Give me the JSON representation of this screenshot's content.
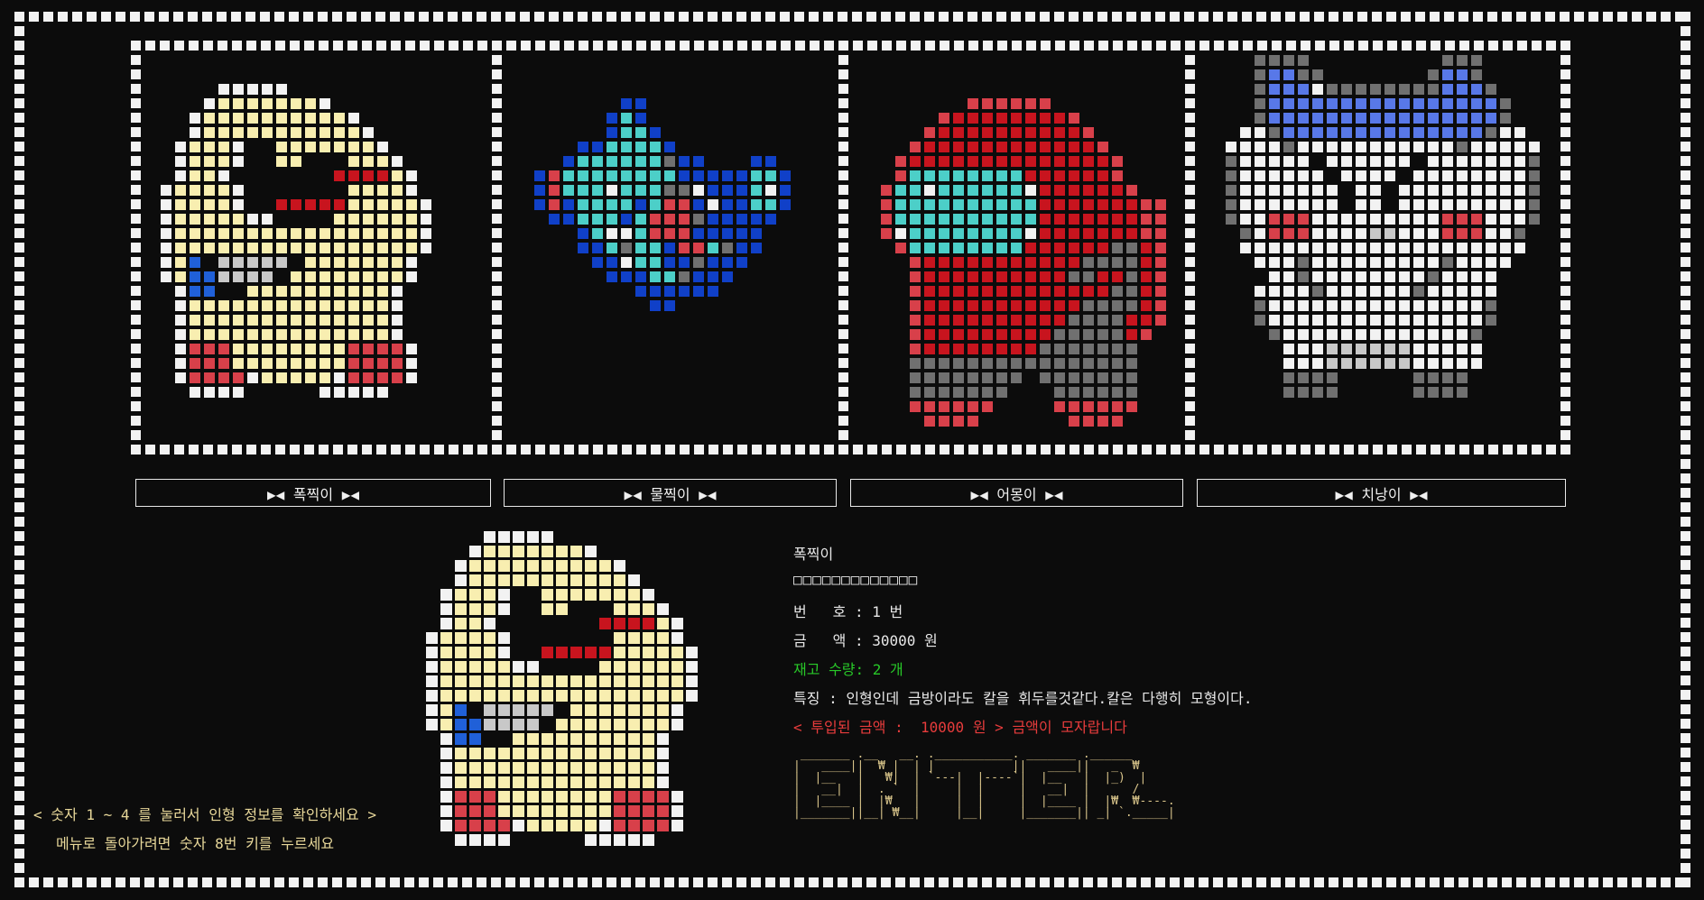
{
  "colors": {
    "W": "#f2f2f2",
    "Y": "#f8eeb0",
    "R": "#d8404a",
    "D": "#c8141e",
    "B": "#2060d8",
    "K": "#1040c8",
    "C": "#4ccfc8",
    "G": "#c8c8c8",
    "M": "#707070",
    "A": "#5878e8",
    "status_green": "#28c828",
    "warn_red": "#e83c3c",
    "hint_yellow": "#e8d89a"
  },
  "dolls": [
    {
      "label": "▶◀  폭찍이  ▶◀",
      "sprite": "pokjjik"
    },
    {
      "label": "▶◀  물찍이  ▶◀",
      "sprite": "muljjik"
    },
    {
      "label": "▶◀  어몽이  ▶◀",
      "sprite": "eomong"
    },
    {
      "label": "▶◀  치낭이  ▶◀",
      "sprite": "chinang"
    }
  ],
  "sprites": {
    "pokjjik": [
      "....WWWWW.........",
      "...WYYYYYYYW......",
      "..WYYYYYYYYYYW....",
      "..WYYYYYYYYYYYW...",
      ".WYYYW..YYYYYYYW..",
      ".WYYYW..YY...YYYW.",
      ".WYYW.......DDDDYW",
      "WYYYYW.......YYYYW",
      "WYYYYW..DDDDDYYYYYW",
      "WYYYYYWW....YYYYYYW",
      "WYYYYYYYYYYYYYYYYYW",
      "WYYYYYYYYYYYYYYYYYW",
      "WYB.GGGGG.YYYYYYYW",
      "WYBBGGGG.YYYYYYYYW",
      ".WBB..YYYYYYYYYYW.",
      ".WYYYYYYYYYYYYYYW.",
      ".WYYYYYYYYYYYYYYW.",
      ".WYYYYYYYYYYYYYYW.",
      ".WRRRYYYYYYYYRRRRW",
      ".WRRRYYYYYYYYRRRRW",
      ".WRRRRWYYYYYWRRRRW",
      "..WWWW.....WWWWW.."
    ],
    "muljjik": [
      "......KK..........",
      ".....KCK..........",
      ".....KCCK.........",
      "...KKCCCCK........",
      "..KCCCCCCMKK...KK.",
      "KRCCCCCCCCKKKKKCCK",
      "KRCCCWCCCMMWKKKCWK",
      "KRKCCCCKCRRKWKKCCK",
      ".KKCCCKCRRRMKKKKK.",
      "...KCWWCRRRKKKKK..",
      "...KKCMCCKRRCMKK..",
      "....KKWCCKKMKKK...",
      ".....KKKCCMKKK....",
      ".......KKKKKK.....",
      "........KK........"
    ],
    "eomong": [
      "......RRRRRR......",
      "....RDDDDDDDDR....",
      "...RDDDDDDDDDDR...",
      "..RDDDDDDDDDDDDR..",
      ".RDDDDDDDDDDDDDDR.",
      ".RCCCCCCCCDDDDDDR.",
      "RCCWCCCCCCWDDDDDDR",
      "RCCCCCCCCCCDDDDDDDRR",
      "RCCCCCCCCCCDDDDDDDRR",
      "RWCCCCCCCCWDDDDDDDRR",
      ".RCCCCCCCCDDDDDDMMDR",
      "..RDDDDDDDDDDDMMMMDR",
      "..RDDDDDDDDDDMMDDMDR",
      "..RDDDDDDDDDDDDDMMDR",
      "..RDDDDDDDDDDDMMMMDR",
      "..RDDDDDDDDDDMMMMDDR",
      "..RDDDDDDDDDMMMMMDR.",
      "..RDDDDDDDDMMMMMMM..",
      "..MMMMMMMMMMMMMMMM..",
      "..MMMMMMMM.MMMMMMM..",
      "..MMMMMMM...MMMMMM..",
      "..RRRRRR....RRRRRR..",
      "...RRRR......RRRR..."
    ],
    "chinang": [
      "..MMMM.........MMM....",
      "..MAAMM.......MAAM....",
      "..MAAAWMMMMMMMMAAAM...",
      "..MAAAAAAAAAAAAAAAAM..",
      "..MAAAAAAAAAAAAAAAAM..",
      ".WWMAAAAAAAAAAAAAAMWW.",
      "WWWWMWWWWWWWWWWWMWWWWW",
      "MWWWWW.WWWWWW.WWWWWWWM",
      "MWWWWWW.WWWW.WWWWWWWWM",
      "MWWWWWWW.WW.WWWWWWWWWM",
      "MWWWWWWW.WW.WWWWWWWWWM",
      "MWWRRRWWWWWWWWWRRRWWWM",
      ".MWRRRWWWWGGWWWRRRWWM.",
      ".WWWWWWWWWWWWWWWWWWWW.",
      "..WWWMWWWWWWWWWMWWWW..",
      "...WWMWWWWWWWWMWWWW...",
      "..WWWWMWWWWWWMWWWWW...",
      "..MWWWWWWWWWWWWWWWM...",
      "..MWWWWWWWWWWWWWWWM...",
      "...MWWWWWWWWWWWWWM....",
      "....WWWGGGGGGWWWWW....",
      "....WWWGGGGGGWWWWW....",
      "....MMMM.....MMMM.....",
      "....MMMM.....MMMM....."
    ]
  },
  "detail": {
    "name": "폭찍이",
    "boxes": "□□□□□□□□□□□□□",
    "number": "번   호 : 1 번",
    "price": "금   액 : 30000 원",
    "stock": "재고 수량: 2 개",
    "feature": "특징 : 인형인데 금방이라도 칼을 휘두를것같다.칼은 다행히 모형이다.",
    "inserted": "< 투입된 금액 :  10000 원 > 금액이 모자랍니다"
  },
  "hint": {
    "line1": "< 숫자 1 ~ 4 를 눌러서 인형 정보를 확인하세요 >",
    "line2": "메뉴로 돌아가려면 숫자 8번 키를 누르세요"
  },
  "enter_art": " _______ .__   __. .___________. _______ .______      \n|   ____||  ₩ |  | |           ||   ____||   _  ₩     \n|  |__   |   ₩|  | `---|  |----`|  |__   |  |_)  |    \n|   __|  |  . `  |     |  |     |   __|  |      /     \n|  |____ |  |₩   |     |  |     |  |____ |  |₩  ₩----.\n|_______||__| ₩__|     |__|     |_______|| _| `._____|"
}
